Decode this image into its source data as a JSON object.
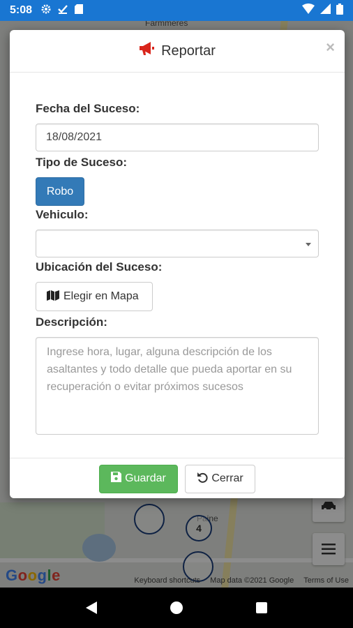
{
  "status_bar": {
    "time": "5:08",
    "icons_left": [
      "gear-icon",
      "check-download-icon",
      "sd-card-icon"
    ],
    "icons_right": [
      "wifi-icon",
      "signal-icon",
      "battery-icon"
    ]
  },
  "map": {
    "label_farm": "Farmmeres",
    "label_paine": "Paine",
    "marker_count": "4",
    "google_letters": [
      "G",
      "o",
      "o",
      "g",
      "l",
      "e"
    ],
    "attribution": [
      "Keyboard shortcuts",
      "Map data ©2021 Google",
      "Terms of Use"
    ]
  },
  "modal": {
    "title": "Reportar",
    "close": "×",
    "fecha_label": "Fecha del Suceso:",
    "fecha_value": "18/08/2021",
    "tipo_label": "Tipo de Suceso:",
    "tipo_button": "Robo",
    "vehiculo_label": "Vehiculo:",
    "vehiculo_value": "",
    "ubicacion_label": "Ubicación del Suceso:",
    "mapa_button": "Elegir en Mapa",
    "descripcion_label": "Descripción:",
    "descripcion_placeholder": "Ingrese hora, lugar, alguna descripción de los asaltantes y todo detalle que pueda aportar en su recuperación o evitar próximos sucesos",
    "guardar_button": "Guardar",
    "cerrar_button": "Cerrar"
  },
  "colors": {
    "status_bar": "#1976d2",
    "primary": "#337ab7",
    "success": "#5cb85c",
    "megaphone": "#d9261c"
  }
}
